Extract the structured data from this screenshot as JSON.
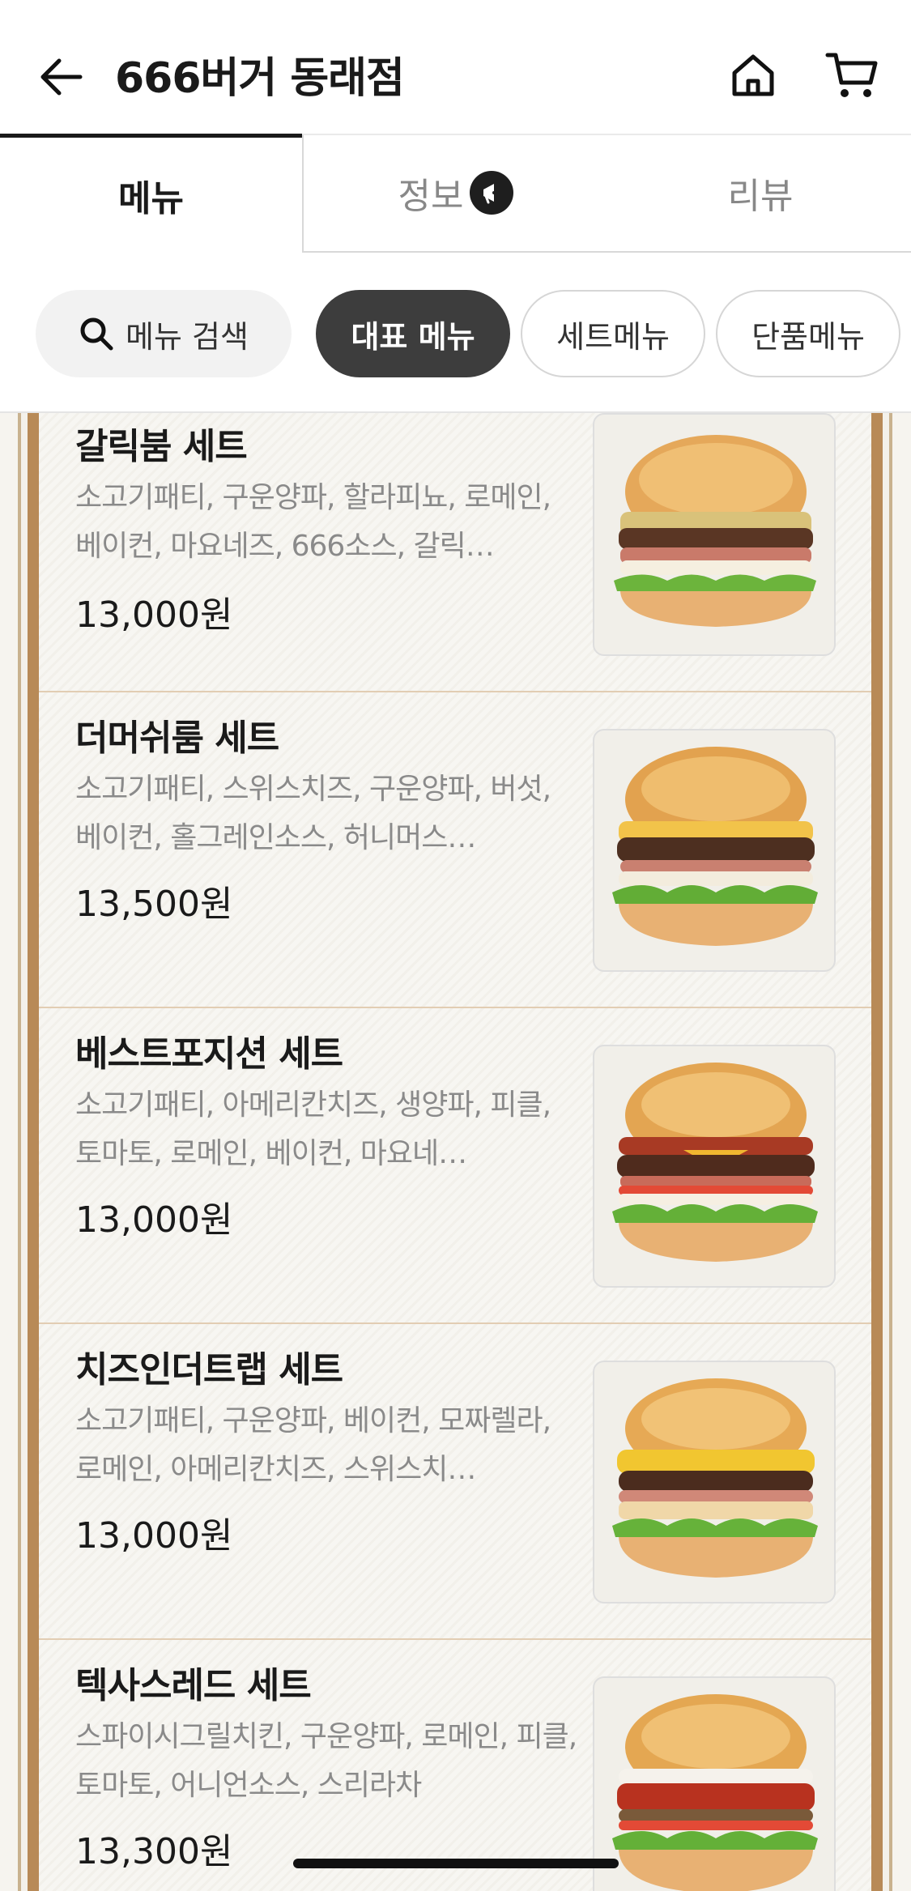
{
  "header": {
    "title": "666버거 동래점",
    "back_icon": "arrow-left-icon",
    "home_icon": "home-icon",
    "cart_icon": "cart-icon"
  },
  "tabs": [
    {
      "label": "메뉴",
      "active": true
    },
    {
      "label": "정보",
      "active": false,
      "badge_icon": "megaphone-icon"
    },
    {
      "label": "리뷰",
      "active": false
    }
  ],
  "filters": {
    "search_label": "메뉴 검색",
    "search_icon": "search-icon",
    "chips": [
      {
        "label": "대표 메뉴",
        "active": true
      },
      {
        "label": "세트메뉴",
        "active": false
      },
      {
        "label": "단품메뉴",
        "active": false
      }
    ]
  },
  "menu_items": [
    {
      "name": "갈릭붐 세트",
      "desc": "소고기패티, 구운양파, 할라피뇨, 로메인, 베이컨, 마요네즈, 666소스, 갈릭…",
      "price": "13,000원",
      "image_icon": "burger-image"
    },
    {
      "name": "더머쉬룸 세트",
      "desc": "소고기패티, 스위스치즈, 구운양파, 버섯, 베이컨, 홀그레인소스, 허니머스…",
      "price": "13,500원",
      "image_icon": "burger-image"
    },
    {
      "name": "베스트포지션 세트",
      "desc": "소고기패티, 아메리칸치즈, 생양파, 피클, 토마토, 로메인, 베이컨, 마요네…",
      "price": "13,000원",
      "image_icon": "burger-image"
    },
    {
      "name": "치즈인더트랩 세트",
      "desc": "소고기패티, 구운양파, 베이컨, 모짜렐라, 로메인, 아메리칸치즈, 스위스치…",
      "price": "13,000원",
      "image_icon": "burger-image"
    },
    {
      "name": "텍사스레드 세트",
      "desc": "스파이시그릴치킨, 구운양파, 로메인, 피클, 토마토, 어니언소스, 스리라차",
      "price": "13,300원",
      "image_icon": "burger-image"
    }
  ],
  "colors": {
    "accent_dark": "#3d3d3d",
    "frame_brown": "#b88a57",
    "text_muted": "#8a8a8a"
  }
}
